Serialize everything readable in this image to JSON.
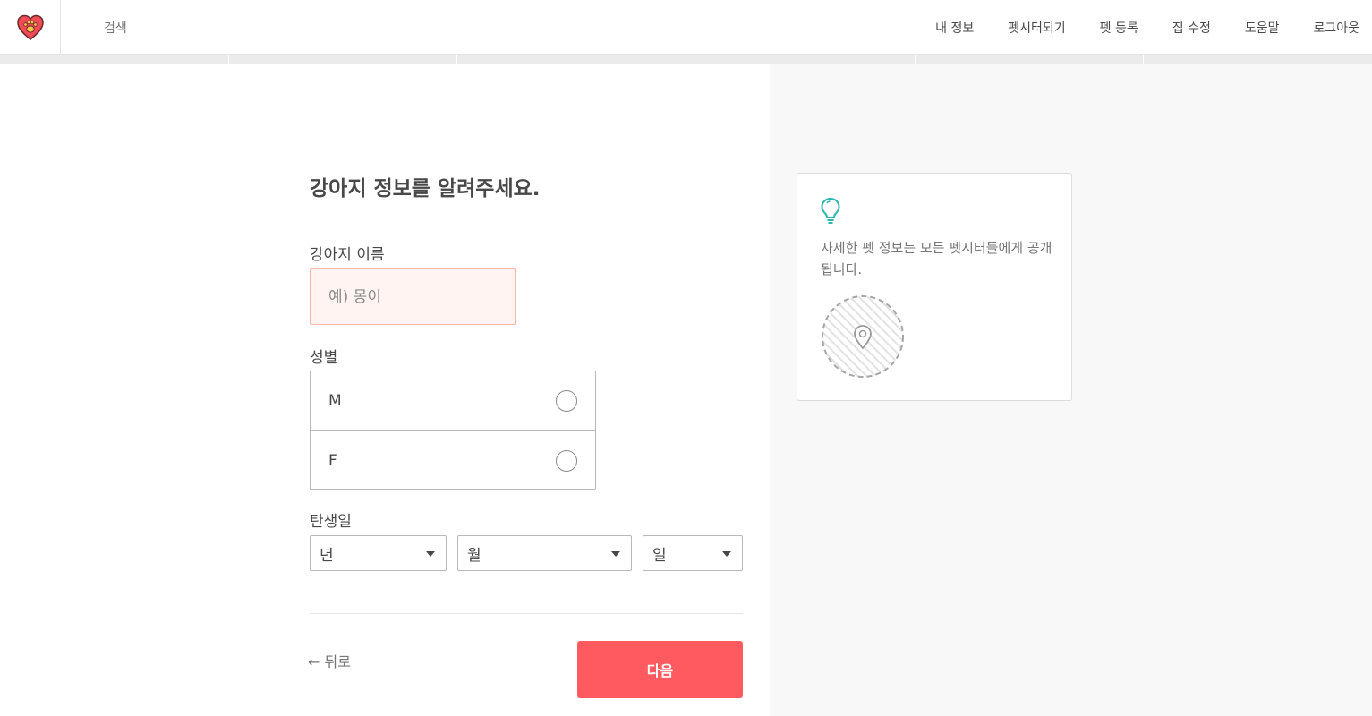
{
  "header": {
    "logo_icon": "heart-paw-logo-icon",
    "search_label": "검색",
    "nav": [
      {
        "label": "내 정보"
      },
      {
        "label": "펫시터되기"
      },
      {
        "label": "펫 등록"
      },
      {
        "label": "집 수정"
      },
      {
        "label": "도움말"
      },
      {
        "label": "로그아웃"
      }
    ]
  },
  "progress": {
    "steps_total": 6
  },
  "form": {
    "title": "강아지 정보를 알려주세요.",
    "name_label": "강아지 이름",
    "name_placeholder": "예) 몽이",
    "name_value": "",
    "gender_label": "성별",
    "gender_options": [
      {
        "label": "M",
        "selected": false
      },
      {
        "label": "F",
        "selected": false
      }
    ],
    "birth_label": "탄생일",
    "birth_year": "년",
    "birth_month": "월",
    "birth_day": "일",
    "back_label": "← 뒤로",
    "next_label": "다음"
  },
  "tip": {
    "icon": "lightbulb-icon",
    "text": "자세한 펫 정보는 모든 펫시터들에게 공개됩니다.",
    "map_icon": "location-pin-icon"
  },
  "colors": {
    "accent": "#ff5a5f",
    "teal": "#2cb8b0",
    "input_error_bg": "#fff4f2",
    "input_error_border": "#ffb4a6",
    "panel_bg": "#f8f8f8"
  }
}
